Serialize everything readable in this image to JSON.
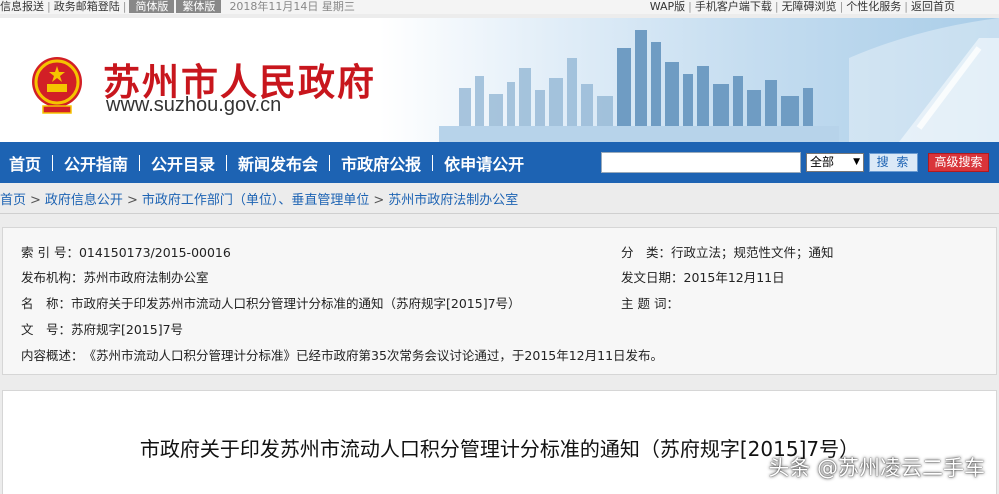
{
  "topbar": {
    "left_items": [
      "信息报送",
      "政务邮箱登陆"
    ],
    "lang_pills": [
      "简体版",
      "繁体版"
    ],
    "date": "2018年11月14日 星期三",
    "right_items": [
      "WAP版",
      "手机客户端下载",
      "无障碍浏览",
      "个性化服务",
      "返回首页"
    ]
  },
  "banner": {
    "title": "苏州市人民政府",
    "url": "www.suzhou.gov.cn"
  },
  "nav": {
    "items": [
      "首页",
      "公开指南",
      "公开目录",
      "新闻发布会",
      "市政府公报",
      "依申请公开"
    ],
    "search_placeholder": "",
    "scope_value": "全部",
    "search_label": "搜 索",
    "advanced_label": "高级搜索"
  },
  "breadcrumb": [
    "首页",
    "政府信息公开",
    "市政府工作部门（单位）、垂直管理单位",
    "苏州市政府法制办公室"
  ],
  "info": {
    "index_label": "索 引 号：",
    "index_value": "014150173/2015-00016",
    "category_label": "分　类：",
    "category_value": "行政立法；规范性文件；通知",
    "publisher_label": "发布机构：",
    "publisher_value": "苏州市政府法制办公室",
    "date_label": "发文日期：",
    "date_value": "2015年12月11日",
    "name_label": "名　称：",
    "name_value": "市政府关于印发苏州市流动人口积分管理计分标准的通知（苏府规字[2015]7号）",
    "subject_label": "主 题 词：",
    "subject_value": "",
    "docno_label": "文　号：",
    "docno_value": "苏府规字[2015]7号",
    "summary_label": "内容概述：",
    "summary_value": "《苏州市流动人口积分管理计分标准》已经市政府第35次常务会议讨论通过，于2015年12月11日发布。"
  },
  "document": {
    "title": "市政府关于印发苏州市流动人口积分管理计分标准的通知（苏府规字[2015]7号）"
  },
  "watermark": "头条 @苏州凌云二手车",
  "colors": {
    "nav_blue": "#1d63b3",
    "brand_red": "#c8161d",
    "adv_red": "#d9343a"
  }
}
